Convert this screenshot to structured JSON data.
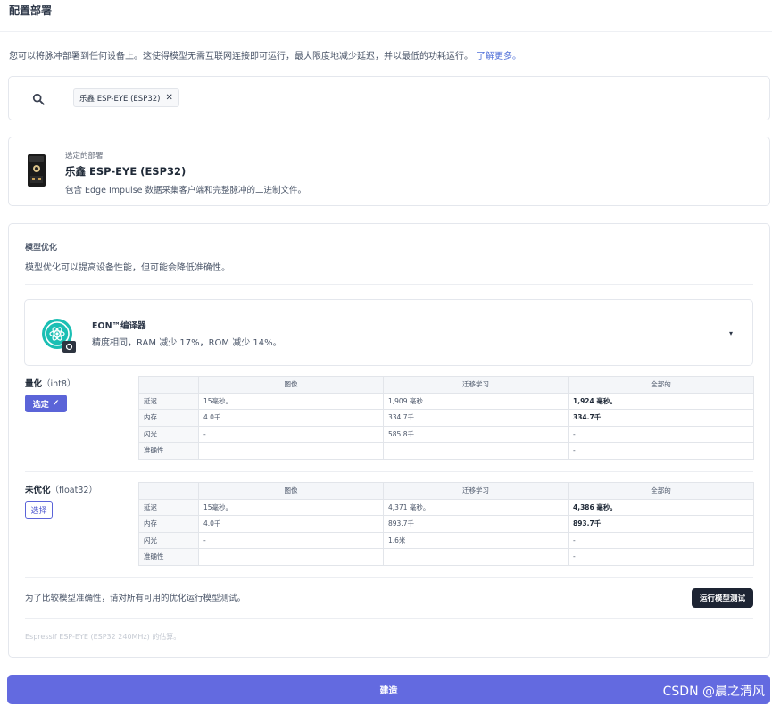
{
  "header": {
    "title": "配置部署"
  },
  "intro": {
    "text": "您可以将脉冲部署到任何设备上。这使得模型无需互联网连接即可运行，最大限度地减少延迟，并以最低的功耗运行。",
    "link": "了解更多。"
  },
  "search": {
    "icon": "search-icon",
    "chip_label": "乐鑫 ESP-EYE (ESP32)",
    "chip_close": "✕"
  },
  "selected": {
    "caption": "选定的部署",
    "name": "乐鑫 ESP-EYE (ESP32)",
    "description": "包含 Edge Impulse 数据采集客户端和完整脉冲的二进制文件。"
  },
  "optimization": {
    "title": "模型优化",
    "subtitle": "模型优化可以提高设备性能，但可能会降低准确性。",
    "compiler": {
      "name": "EON™编译器",
      "description": "精度相同，RAM 减少 17%，ROM 减少 14%。",
      "caret": "▾"
    },
    "variants": [
      {
        "label": "量化",
        "label_suffix": "（int8）",
        "button": "选定",
        "button_icon": "✔",
        "table": {
          "headers": [
            "",
            "图像",
            "迁移学习",
            "全部的"
          ],
          "rows": [
            [
              "延迟",
              "15毫秒。",
              "1,909 毫秒",
              "1,924 毫秒。"
            ],
            [
              "内存",
              "4.0千",
              "334.7千",
              "334.7千"
            ],
            [
              "闪光",
              "-",
              "585.8千",
              "-"
            ],
            [
              "准确性",
              "",
              "",
              "-"
            ]
          ]
        }
      },
      {
        "label": "未优化",
        "label_suffix": "（float32）",
        "button": "选择",
        "table": {
          "headers": [
            "",
            "图像",
            "迁移学习",
            "全部的"
          ],
          "rows": [
            [
              "延迟",
              "15毫秒。",
              "4,371 毫秒。",
              "4,386 毫秒。"
            ],
            [
              "内存",
              "4.0千",
              "893.7千",
              "893.7千"
            ],
            [
              "闪光",
              "-",
              "1.6米",
              "-"
            ],
            [
              "准确性",
              "",
              "",
              "-"
            ]
          ]
        }
      }
    ],
    "compare_text": "为了比较模型准确性，请对所有可用的优化运行模型测试。",
    "run_button": "运行模型测试",
    "estimate_note": "Espressif ESP-EYE (ESP32 240MHz) 的估算。"
  },
  "build_button": "建造",
  "watermark": "CSDN @晨之清风",
  "colors": {
    "primary": "#636ae0",
    "dark_button": "#1d2433",
    "eon_teal": "#1bbfb4",
    "link": "#4f6fd8"
  }
}
